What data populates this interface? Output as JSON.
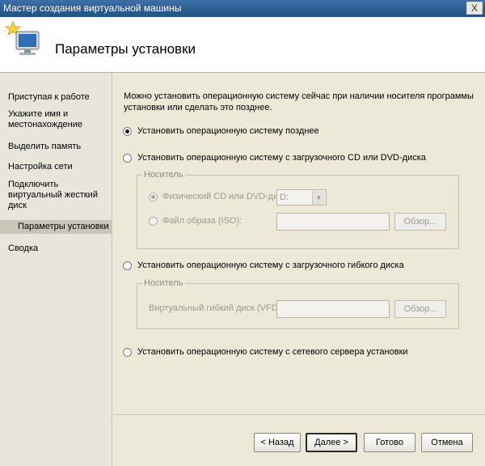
{
  "window": {
    "title": "Мастер создания виртуальной машины",
    "close_label": "X"
  },
  "header": {
    "page_title": "Параметры установки"
  },
  "sidebar": {
    "items": [
      {
        "label": "Приступая к работе"
      },
      {
        "label": "Укажите имя и местонахождение"
      },
      {
        "label": "Выделить память"
      },
      {
        "label": "Настройка сети"
      },
      {
        "label": "Подключить виртуальный жесткий диск"
      },
      {
        "label": "Параметры установки",
        "active": true
      },
      {
        "label": "Сводка"
      }
    ]
  },
  "main": {
    "intro": "Можно установить операционную систему сейчас при наличии носителя программы установки или сделать это позднее.",
    "options": {
      "later": {
        "label": "Установить операционную систему позднее",
        "selected": true
      },
      "cd": {
        "label": "Установить операционную систему с загрузочного CD или DVD-диска",
        "selected": false
      },
      "floppy": {
        "label": "Установить операционную систему с загрузочного гибкого диска",
        "selected": false
      },
      "network": {
        "label": "Установить операционную систему с сетевого сервера установки",
        "selected": false
      }
    },
    "cd_group": {
      "legend": "Носитель",
      "physical_label": "Физический CD или DVD-диск:",
      "physical_drive_value": "D:",
      "image_label": "Файл образа (ISO):",
      "image_value": "",
      "browse_label": "Обзор..."
    },
    "floppy_group": {
      "legend": "Носитель",
      "vfd_label": "Виртуальный гибкий диск (VFD):",
      "vfd_value": "",
      "browse_label": "Обзор..."
    }
  },
  "footer": {
    "back_label": "< Назад",
    "next_label": "Далее >",
    "finish_label": "Готово",
    "cancel_label": "Отмена"
  }
}
